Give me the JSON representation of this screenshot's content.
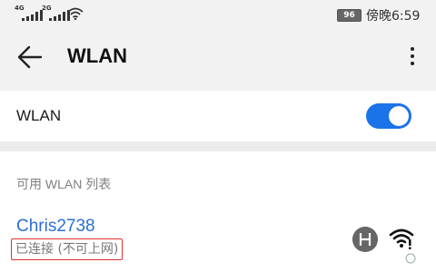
{
  "status_bar": {
    "signal1_label": "4G",
    "signal2_label": "2G",
    "battery_level": "96",
    "time": "傍晚6:59",
    "icons": [
      "signal-icon",
      "signal-icon",
      "wifi-icon",
      "battery-icon"
    ]
  },
  "header": {
    "title": "WLAN",
    "back_icon": "arrow-left-icon",
    "menu_icon": "more-vertical-icon"
  },
  "wlan_toggle": {
    "label": "WLAN",
    "enabled": true,
    "accent_color": "#1a73e8"
  },
  "available_networks": {
    "section_title": "可用 WLAN 列表",
    "items": [
      {
        "ssid": "Chris2738",
        "status": "已连接 (不可上网)",
        "icons": [
          "hotspot-icon",
          "wifi-warning-icon"
        ]
      }
    ]
  },
  "colors": {
    "ssid": "#2a6fd2",
    "status_box": "#e03030",
    "background": "#f2f2f2"
  }
}
